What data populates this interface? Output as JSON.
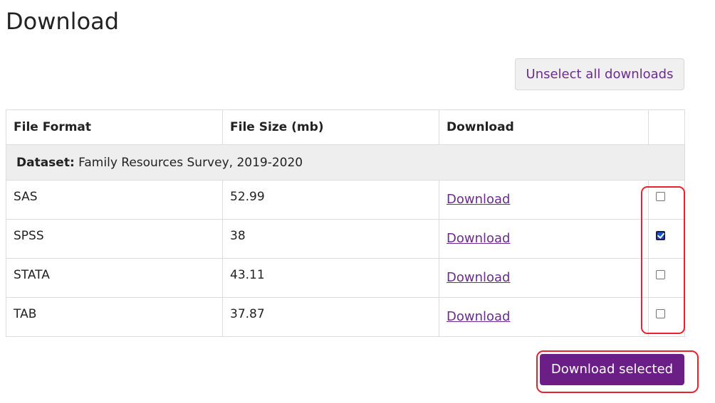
{
  "page": {
    "title": "Download"
  },
  "toolbar": {
    "unselect_label": "Unselect all downloads"
  },
  "table": {
    "headers": {
      "format": "File Format",
      "size": "File Size (mb)",
      "download": "Download",
      "select": ""
    },
    "dataset": {
      "label": "Dataset:",
      "name": "Family Resources Survey, 2019-2020"
    },
    "rows": [
      {
        "format": "SAS",
        "size": "52.99",
        "link": "Download",
        "checked": false
      },
      {
        "format": "SPSS",
        "size": "38",
        "link": "Download",
        "checked": true
      },
      {
        "format": "STATA",
        "size": "43.11",
        "link": "Download",
        "checked": false
      },
      {
        "format": "TAB",
        "size": "37.87",
        "link": "Download",
        "checked": false
      }
    ]
  },
  "footer": {
    "download_selected_label": "Download selected"
  },
  "colors": {
    "accent": "#6b1f86",
    "link": "#6b2c8f",
    "highlight": "#e8232f",
    "dataset_bg": "#eeeeee"
  }
}
